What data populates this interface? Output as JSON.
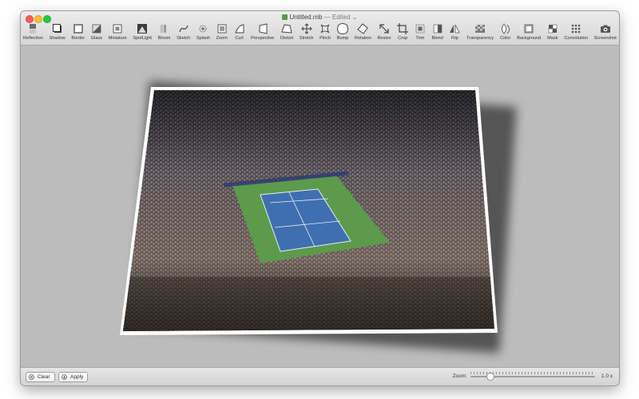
{
  "window": {
    "title": "Untitled.rnb",
    "separator": "—",
    "status": "Edited",
    "title_chevron": "⌄"
  },
  "toolbar": {
    "tools": [
      {
        "label": "Reflection",
        "icon": "reflection-icon"
      },
      {
        "label": "Shadow",
        "icon": "shadow-icon"
      },
      {
        "label": "Border",
        "icon": "border-icon"
      },
      {
        "label": "Glass",
        "icon": "glass-icon"
      },
      {
        "label": "Miniature",
        "icon": "miniature-icon"
      },
      {
        "label": "SpotLight",
        "icon": "spotlight-icon"
      },
      {
        "label": "Bloom",
        "icon": "bloom-icon"
      },
      {
        "label": "Sketch",
        "icon": "sketch-icon"
      },
      {
        "label": "Splash",
        "icon": "splash-icon"
      },
      {
        "label": "Zoom",
        "icon": "zoom-icon"
      },
      {
        "label": "Curl",
        "icon": "curl-icon"
      },
      {
        "label": "Perspective",
        "icon": "perspective-icon"
      },
      {
        "label": "Distort",
        "icon": "distort-icon"
      },
      {
        "label": "Stretch",
        "icon": "stretch-icon"
      },
      {
        "label": "Pinch",
        "icon": "pinch-icon"
      },
      {
        "label": "Bump",
        "icon": "bump-icon"
      },
      {
        "label": "Rotation",
        "icon": "rotation-icon"
      },
      {
        "label": "Resize",
        "icon": "resize-icon"
      },
      {
        "label": "Crop",
        "icon": "crop-icon"
      },
      {
        "label": "Trim",
        "icon": "trim-icon"
      },
      {
        "label": "Blend",
        "icon": "blend-icon"
      },
      {
        "label": "Flip",
        "icon": "flip-icon"
      },
      {
        "label": "Transparency",
        "icon": "transparency-icon"
      },
      {
        "label": "Color",
        "icon": "color-icon"
      },
      {
        "label": "Background",
        "icon": "background-icon"
      },
      {
        "label": "Mask",
        "icon": "mask-icon"
      },
      {
        "label": "Convolution",
        "icon": "convolution-icon"
      },
      {
        "label": "Screenshot",
        "icon": "screenshot-icon"
      }
    ]
  },
  "canvas": {
    "background_color": "#bcbcbc"
  },
  "footer": {
    "clear_label": "Clear",
    "apply_label": "Apply",
    "zoom_label": "Zoom:",
    "zoom_value": "1.0 x",
    "zoom_fraction": 0.16
  }
}
